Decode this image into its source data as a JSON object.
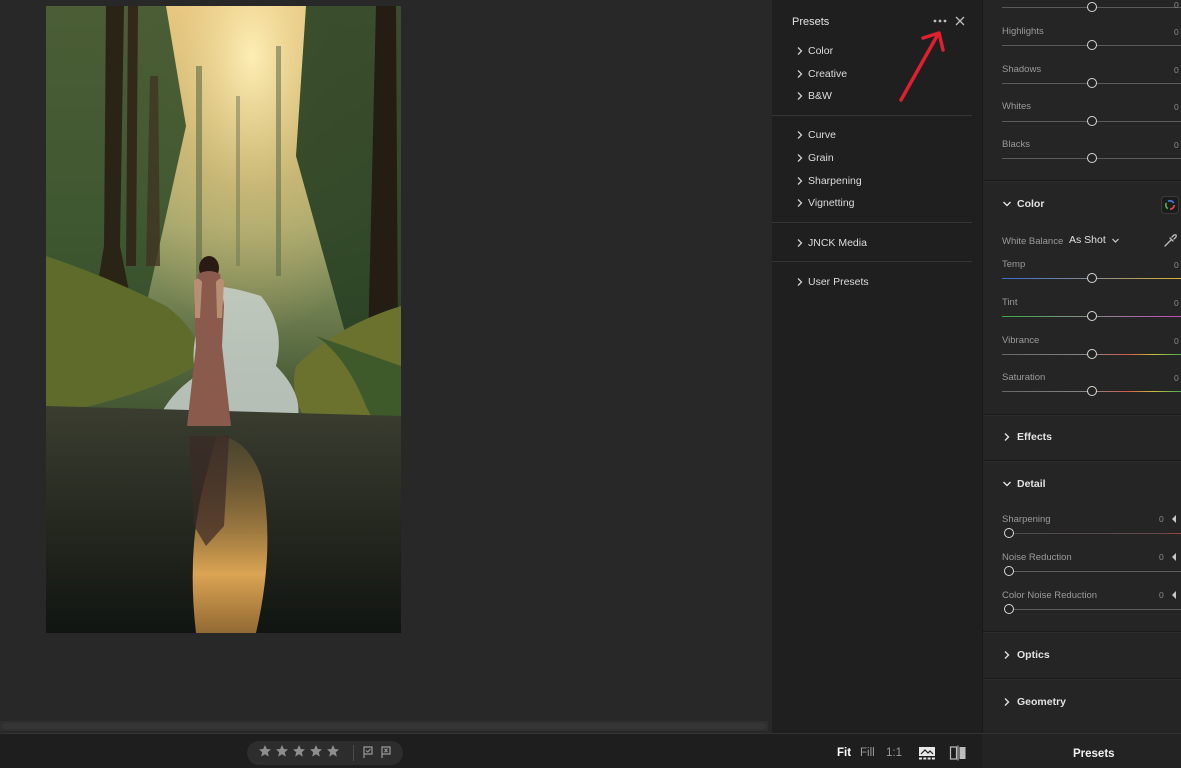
{
  "presets_panel": {
    "title": "Presets",
    "groups": [
      {
        "items": [
          "Color",
          "Creative",
          "B&W"
        ]
      },
      {
        "items": [
          "Curve",
          "Grain",
          "Sharpening",
          "Vignetting"
        ]
      },
      {
        "items": [
          "JNCK Media"
        ]
      },
      {
        "items": [
          "User Presets"
        ]
      }
    ]
  },
  "light": {
    "sliders": [
      {
        "label": "",
        "value": "0",
        "level": 0.5
      },
      {
        "label": "Highlights",
        "value": "0",
        "level": 0.5
      },
      {
        "label": "Shadows",
        "value": "0",
        "level": 0.5
      },
      {
        "label": "Whites",
        "value": "0",
        "level": 0.5
      },
      {
        "label": "Blacks",
        "value": "0",
        "level": 0.5
      }
    ]
  },
  "color": {
    "title": "Color",
    "white_balance_label": "White Balance",
    "white_balance_value": "As Shot",
    "sliders": [
      {
        "label": "Temp",
        "value": "0",
        "level": 0.5
      },
      {
        "label": "Tint",
        "value": "0",
        "level": 0.5
      },
      {
        "label": "Vibrance",
        "value": "0",
        "level": 0.5
      },
      {
        "label": "Saturation",
        "value": "0",
        "level": 0.5
      }
    ]
  },
  "effects": {
    "title": "Effects"
  },
  "detail": {
    "title": "Detail",
    "sliders": [
      {
        "label": "Sharpening",
        "value": "0",
        "level": 0
      },
      {
        "label": "Noise Reduction",
        "value": "0",
        "level": 0
      },
      {
        "label": "Color Noise Reduction",
        "value": "0",
        "level": 0
      }
    ]
  },
  "optics": {
    "title": "Optics"
  },
  "geometry": {
    "title": "Geometry"
  },
  "bottom_bar": {
    "rating_stars": 5,
    "zoom_fit": "Fit",
    "zoom_fill": "Fill",
    "zoom_one": "1:1",
    "presets_tab": "Presets"
  },
  "colors": {
    "annotation_arrow": "#e0202e",
    "panel_bg": "#1f1f1f"
  }
}
